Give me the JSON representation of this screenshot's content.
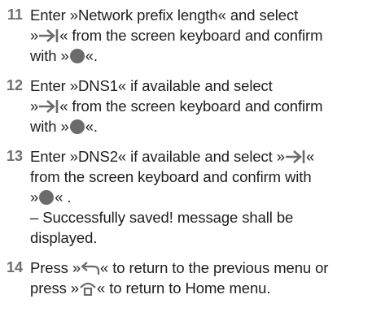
{
  "steps": [
    {
      "number": "11",
      "line1": "Enter »Network prefix length« and select",
      "pre_icon": "»",
      "icon": "next-arrow-icon",
      "post_icon": "« from the screen keyboard and confirm",
      "confirm_pre": "with »",
      "confirm_post": "«."
    },
    {
      "number": "12",
      "line1": "Enter »DNS1« if available and select",
      "pre_icon": "»",
      "icon": "next-arrow-icon",
      "post_icon": "« from the screen keyboard and confirm",
      "confirm_pre": "with »",
      "confirm_post": "«."
    },
    {
      "number": "13",
      "line1_pre": "Enter »DNS2« if available and select »",
      "icon": "next-arrow-icon",
      "line1_post": "«",
      "line2": "from the screen keyboard and confirm with",
      "confirm_pre": "»",
      "confirm_post": "« .",
      "note1": "– Successfully saved! message shall be",
      "note2": "displayed."
    },
    {
      "number": "14",
      "line1_pre": "Press »",
      "icon1": "back-arrow-icon",
      "line1_post": "« to return to the previous menu or",
      "line2_pre": "press »",
      "icon2": "home-icon",
      "line2_post": "« to return to Home menu."
    }
  ],
  "colors": {
    "step_number": "#6e6e6e",
    "body_text": "#1e1e1e",
    "icon": "#6b6b6b"
  }
}
